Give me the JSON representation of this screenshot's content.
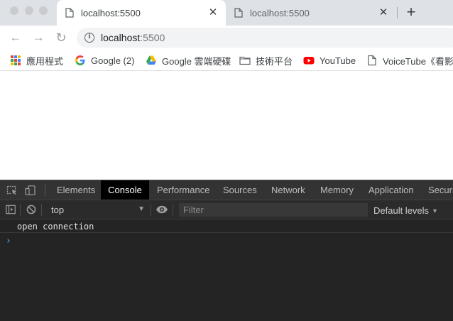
{
  "tabs": [
    {
      "title": "localhost:5500",
      "close": "✕",
      "active": true
    },
    {
      "title": "localhost:5500",
      "close": "✕",
      "active": false
    }
  ],
  "new_tab_glyph": "+",
  "nav": {
    "back": "←",
    "forward": "→",
    "reload": "↻"
  },
  "omnibox": {
    "info_glyph": "i",
    "host": "localhost",
    "port": ":5500"
  },
  "bookmarks": [
    {
      "label": "應用程式",
      "icon": "apps-grid-icon"
    },
    {
      "label": "Google (2)",
      "icon": "google-icon"
    },
    {
      "label": "Google 雲端硬碟",
      "icon": "google-drive-icon"
    },
    {
      "label": "技術平台",
      "icon": "folder-icon"
    },
    {
      "label": "YouTube",
      "icon": "youtube-icon"
    },
    {
      "label": "VoiceTube《看影…",
      "icon": "document-icon"
    }
  ],
  "devtools": {
    "tabs": [
      "Elements",
      "Console",
      "Performance",
      "Sources",
      "Network",
      "Memory",
      "Application",
      "Securi"
    ],
    "active_tab": "Console",
    "console": {
      "context": "top",
      "filter_placeholder": "Filter",
      "levels": "Default levels",
      "messages": [
        "open connection"
      ],
      "prompt": "›"
    }
  },
  "colors": {
    "tabstrip": "#dee1e6",
    "devtools_bg": "#242424",
    "devtools_tabbar": "#333333",
    "prompt": "#6a9fe8",
    "youtube_red": "#ff0000"
  }
}
